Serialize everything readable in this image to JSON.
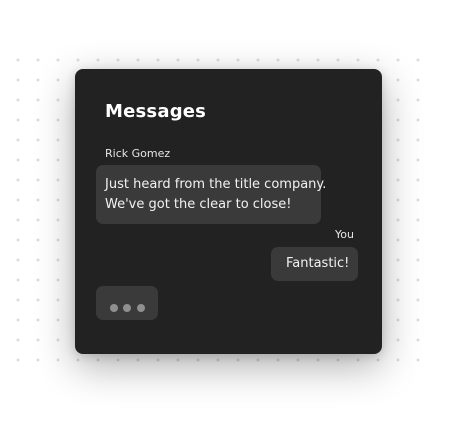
{
  "messages_panel": {
    "title": "Messages",
    "conversation": [
      {
        "sender": "Rick Gomez",
        "direction": "incoming",
        "lines": [
          "Just heard from the title company.",
          "We've got the clear to close!"
        ]
      },
      {
        "sender": "You",
        "direction": "outgoing",
        "text": "Fantastic!"
      }
    ],
    "typing_indicator": {
      "visible": true,
      "dots": 3
    }
  },
  "colors": {
    "page_background": "#ffffff",
    "card_background": "#222222",
    "bubble_background": "#3a3a3a",
    "text": "#f2f2f2",
    "typing_dot": "#8f8f8f",
    "background_dots": "#dcdcdc"
  }
}
